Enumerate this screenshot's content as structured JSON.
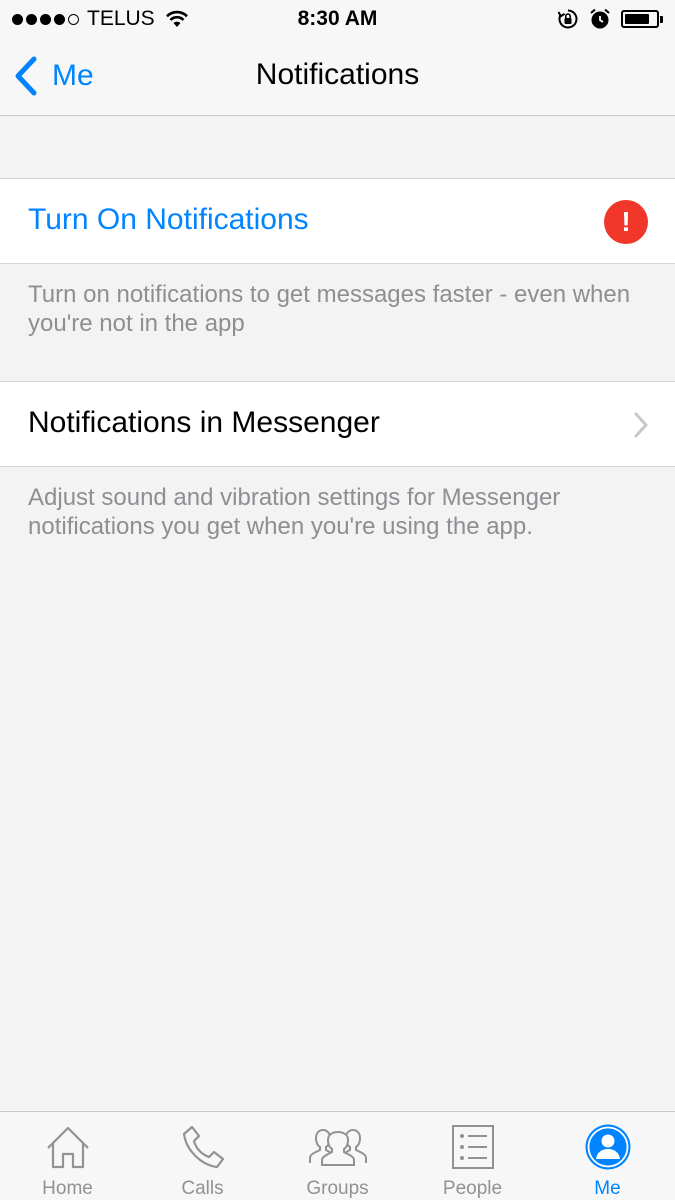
{
  "status_bar": {
    "carrier": "TELUS",
    "time": "8:30 AM",
    "signal_bars_filled": 4,
    "signal_bars_total": 5,
    "battery_level": 0.8
  },
  "nav": {
    "back_label": "Me",
    "title": "Notifications"
  },
  "turn_on": {
    "label": "Turn On Notifications",
    "badge": "!",
    "description": "Turn on notifications to get messages faster - even when you're not in the app"
  },
  "messenger": {
    "label": "Notifications in Messenger",
    "description": "Adjust sound and vibration settings for Messenger notifications you get when you're using the app."
  },
  "tabs": [
    {
      "label": "Home",
      "icon": "home-icon"
    },
    {
      "label": "Calls",
      "icon": "phone-icon"
    },
    {
      "label": "Groups",
      "icon": "groups-icon"
    },
    {
      "label": "People",
      "icon": "people-list-icon"
    },
    {
      "label": "Me",
      "icon": "profile-icon",
      "active": true
    }
  ],
  "colors": {
    "accent": "#0084ff",
    "alert": "#f0372a",
    "background": "#f3f3f3",
    "secondary_text": "#8e8e93"
  }
}
